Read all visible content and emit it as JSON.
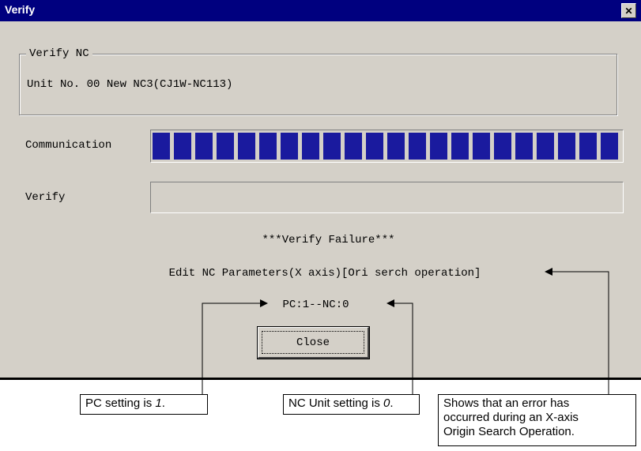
{
  "window": {
    "title": "Verify",
    "close_glyph": "✕"
  },
  "group": {
    "legend": "Verify NC",
    "unit_text": "Unit No. 00 New NC3(CJ1W-NC113)"
  },
  "communication": {
    "label": "Communication",
    "progress": 1.0
  },
  "verify": {
    "label": "Verify",
    "value": ""
  },
  "status": {
    "failure_text": "***Verify Failure***",
    "detail_text": "Edit NC Parameters(X axis)[Ori serch operation]",
    "compare_text": "PC:1--NC:0"
  },
  "buttons": {
    "close_label": "Close"
  },
  "callouts": {
    "pc_prefix": "PC setting is ",
    "pc_value": "1",
    "pc_suffix": ".",
    "nc_prefix": "NC Unit setting is ",
    "nc_value": "0",
    "nc_suffix": ".",
    "error_line1": "Shows that an error has",
    "error_line2": "occurred during an X-axis",
    "error_line3": "Origin Search Operation."
  },
  "colors": {
    "titlebar": "#00007f",
    "progress_block": "#1a1a9e",
    "dialog_face": "#d4d0c8"
  }
}
